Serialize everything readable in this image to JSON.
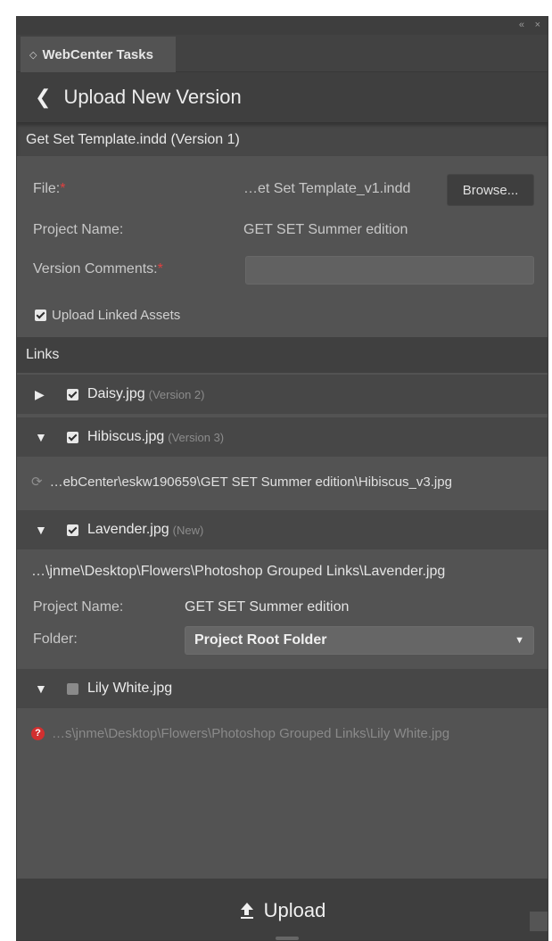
{
  "window": {
    "collapse_glyph": "«",
    "close_glyph": "×"
  },
  "tab": {
    "icon": "◇",
    "label": "WebCenter Tasks"
  },
  "header": {
    "back_glyph": "❮",
    "title": "Upload New Version"
  },
  "document": {
    "title": "Get Set Template.indd (Version 1)"
  },
  "form": {
    "file_label": "File:",
    "file_value": "…et Set Template_v1.indd",
    "browse_label": "Browse...",
    "project_label": "Project Name:",
    "project_value": "GET SET Summer edition",
    "comments_label": "Version Comments:",
    "comments_value": "",
    "required_mark": "*",
    "upload_linked_label": "Upload Linked Assets",
    "upload_linked_checked": true
  },
  "links": {
    "heading": "Links",
    "items": [
      {
        "name": "Daisy.jpg",
        "version": "(Version 2)",
        "expanded": false,
        "checked": true
      },
      {
        "name": "Hibiscus.jpg",
        "version": "(Version 3)",
        "expanded": true,
        "checked": true,
        "path": "…ebCenter\\eskw190659\\GET SET Summer edition\\Hibiscus_v3.jpg"
      },
      {
        "name": "Lavender.jpg",
        "version": "(New)",
        "expanded": true,
        "checked": true,
        "path": "…\\jnme\\Desktop\\Flowers\\Photoshop Grouped Links\\Lavender.jpg",
        "project_label": "Project Name:",
        "project_value": "GET SET Summer edition",
        "folder_label": "Folder:",
        "folder_value": "Project Root Folder"
      },
      {
        "name": "Lily White.jpg",
        "version": "",
        "expanded": true,
        "checked": false,
        "path": "…s\\jnme\\Desktop\\Flowers\\Photoshop Grouped Links\\Lily White.jpg",
        "error_glyph": "?"
      }
    ]
  },
  "footer": {
    "upload_label": "Upload"
  },
  "colors": {
    "panel_bg": "#535353",
    "dark_bar": "#3e3e3e",
    "required": "#e04040",
    "error": "#d12f2f"
  }
}
